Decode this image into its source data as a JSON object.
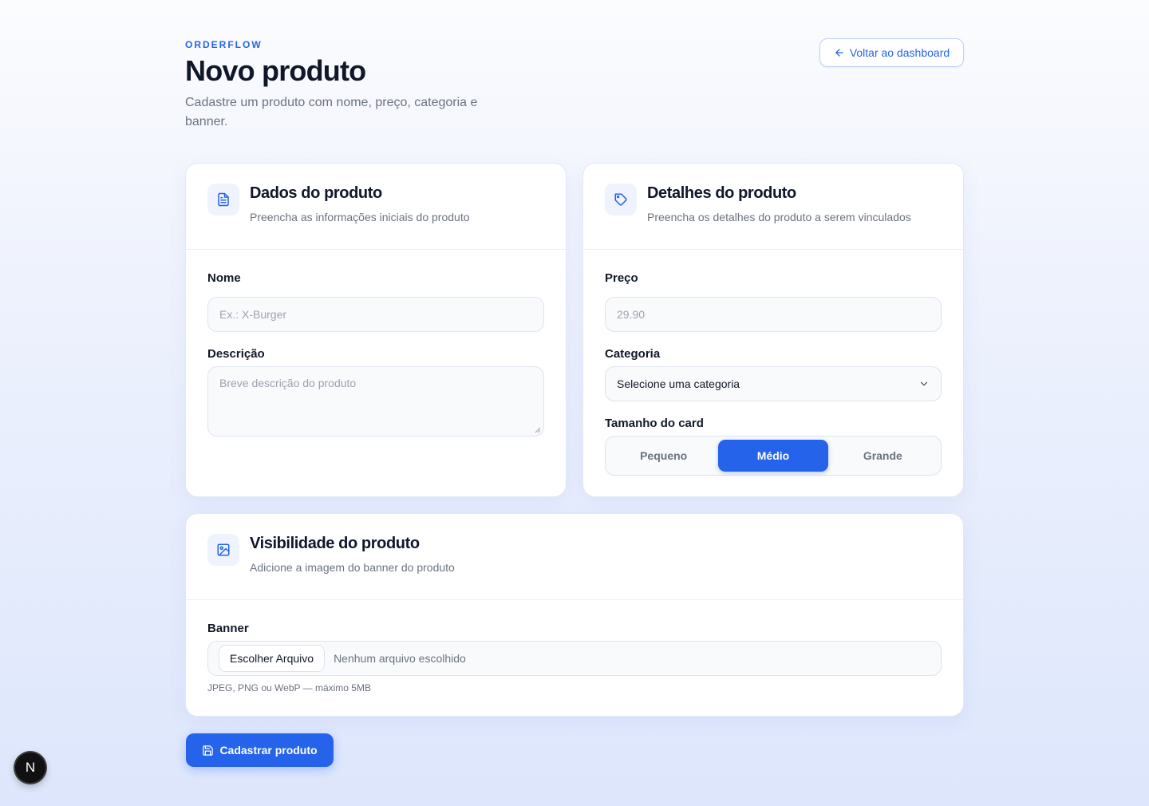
{
  "header": {
    "brand": "ORDERFLOW",
    "title": "Novo produto",
    "subtitle": "Cadastre um produto com nome, preço, categoria e banner.",
    "back_button": "Voltar ao dashboard"
  },
  "product_data_card": {
    "title": "Dados do produto",
    "description": "Preencha as informações iniciais do produto",
    "name_label": "Nome",
    "name_placeholder": "Ex.: X-Burger",
    "description_label": "Descrição",
    "description_placeholder": "Breve descrição do produto"
  },
  "product_details_card": {
    "title": "Detalhes do produto",
    "description": "Preencha os detalhes do produto a serem vinculados",
    "price_label": "Preço",
    "price_placeholder": "29.90",
    "category_label": "Categoria",
    "category_selected": "Selecione uma categoria",
    "size_label": "Tamanho do card",
    "size_options": [
      "Pequeno",
      "Médio",
      "Grande"
    ],
    "size_selected": "Médio"
  },
  "visibility_card": {
    "title": "Visibilidade do produto",
    "description": "Adicione a imagem do banner do produto",
    "banner_label": "Banner",
    "file_button": "Escolher Arquivo",
    "file_status": "Nenhum arquivo escolhido",
    "hint": "JPEG, PNG ou WebP — máximo 5MB"
  },
  "submit_button": "Cadastrar produto",
  "dev_badge": "N",
  "colors": {
    "accent": "#2563eb",
    "text": "#0f172a",
    "muted": "#6b7280"
  }
}
